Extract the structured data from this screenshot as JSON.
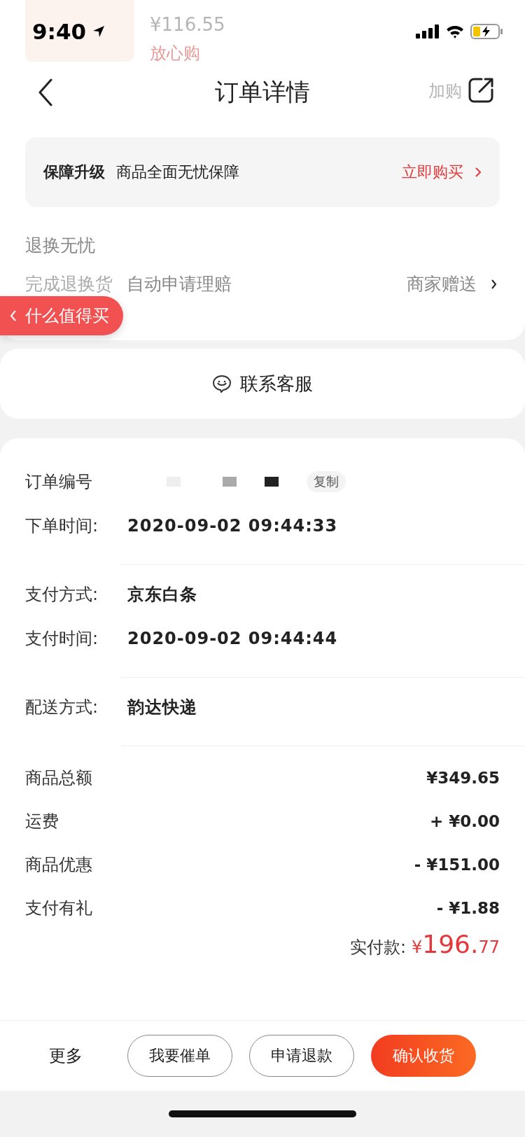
{
  "status_bar": {
    "time": "9:40"
  },
  "ghost": {
    "price": "¥116.55",
    "badge": "放心购",
    "cart_button": "加购"
  },
  "header": {
    "title": "订单详情"
  },
  "protection": {
    "label": "保障升级",
    "text": "商品全面无忧保障",
    "action": "立即购买"
  },
  "service": {
    "title": "退换无忧",
    "items": [
      "完成退换货",
      "自动申请理赔"
    ],
    "right_text": "商家赠送"
  },
  "floating_badge": {
    "text": "什么值得买"
  },
  "contact": {
    "text": "联系客服"
  },
  "order_groups": [
    [
      {
        "kind": "redacted",
        "label": "订单编号",
        "copy": "复制"
      },
      {
        "kind": "text",
        "label": "下单时间:",
        "value": "2020-09-02 09:44:33"
      }
    ],
    [
      {
        "kind": "text",
        "label": "支付方式:",
        "value": "京东白条"
      },
      {
        "kind": "text",
        "label": "支付时间:",
        "value": "2020-09-02 09:44:44"
      }
    ],
    [
      {
        "kind": "text",
        "label": "配送方式:",
        "value": "韵达快递"
      }
    ]
  ],
  "amounts": [
    {
      "label": "商品总额",
      "value": "¥349.65"
    },
    {
      "label": "运费",
      "value": "+ ¥0.00"
    },
    {
      "label": "商品优惠",
      "value": "- ¥151.00"
    },
    {
      "label": "支付有礼",
      "value": "- ¥1.88"
    }
  ],
  "total": {
    "label": "实付款:",
    "currency": "¥",
    "integer": "196.",
    "decimal": "77"
  },
  "bottom_bar": {
    "more": "更多",
    "buttons": [
      {
        "label": "我要催单",
        "primary": false
      },
      {
        "label": "申请退款",
        "primary": false
      },
      {
        "label": "确认收货",
        "primary": true
      }
    ]
  }
}
